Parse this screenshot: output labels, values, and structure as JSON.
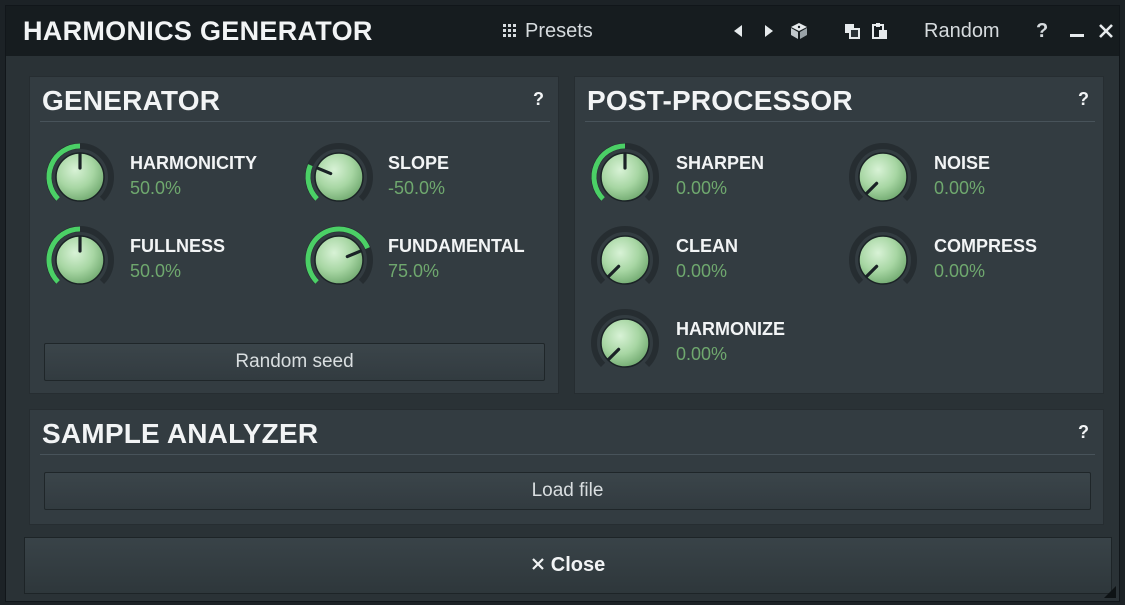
{
  "titlebar": {
    "title": "HARMONICS GENERATOR",
    "presets_label": "Presets",
    "random_label": "Random",
    "help_label": "?"
  },
  "generator": {
    "title": "GENERATOR",
    "help": "?",
    "knobs": [
      {
        "label": "HARMONICITY",
        "value": "50.0%"
      },
      {
        "label": "SLOPE",
        "value": "-50.0%"
      },
      {
        "label": "FULLNESS",
        "value": "50.0%"
      },
      {
        "label": "FUNDAMENTAL",
        "value": "75.0%"
      }
    ],
    "random_seed_label": "Random seed"
  },
  "post_processor": {
    "title": "POST-PROCESSOR",
    "help": "?",
    "knobs": [
      {
        "label": "SHARPEN",
        "value": "0.00%"
      },
      {
        "label": "NOISE",
        "value": "0.00%"
      },
      {
        "label": "CLEAN",
        "value": "0.00%"
      },
      {
        "label": "COMPRESS",
        "value": "0.00%"
      },
      {
        "label": "HARMONIZE",
        "value": "0.00%"
      }
    ]
  },
  "sample_analyzer": {
    "title": "SAMPLE ANALYZER",
    "help": "?",
    "load_file_label": "Load file"
  },
  "close": {
    "label": "Close"
  },
  "colors": {
    "accent_green": "#6fa86e",
    "knob_ring": "#4bd066",
    "panel": "#333c41",
    "background": "#2a3236"
  }
}
